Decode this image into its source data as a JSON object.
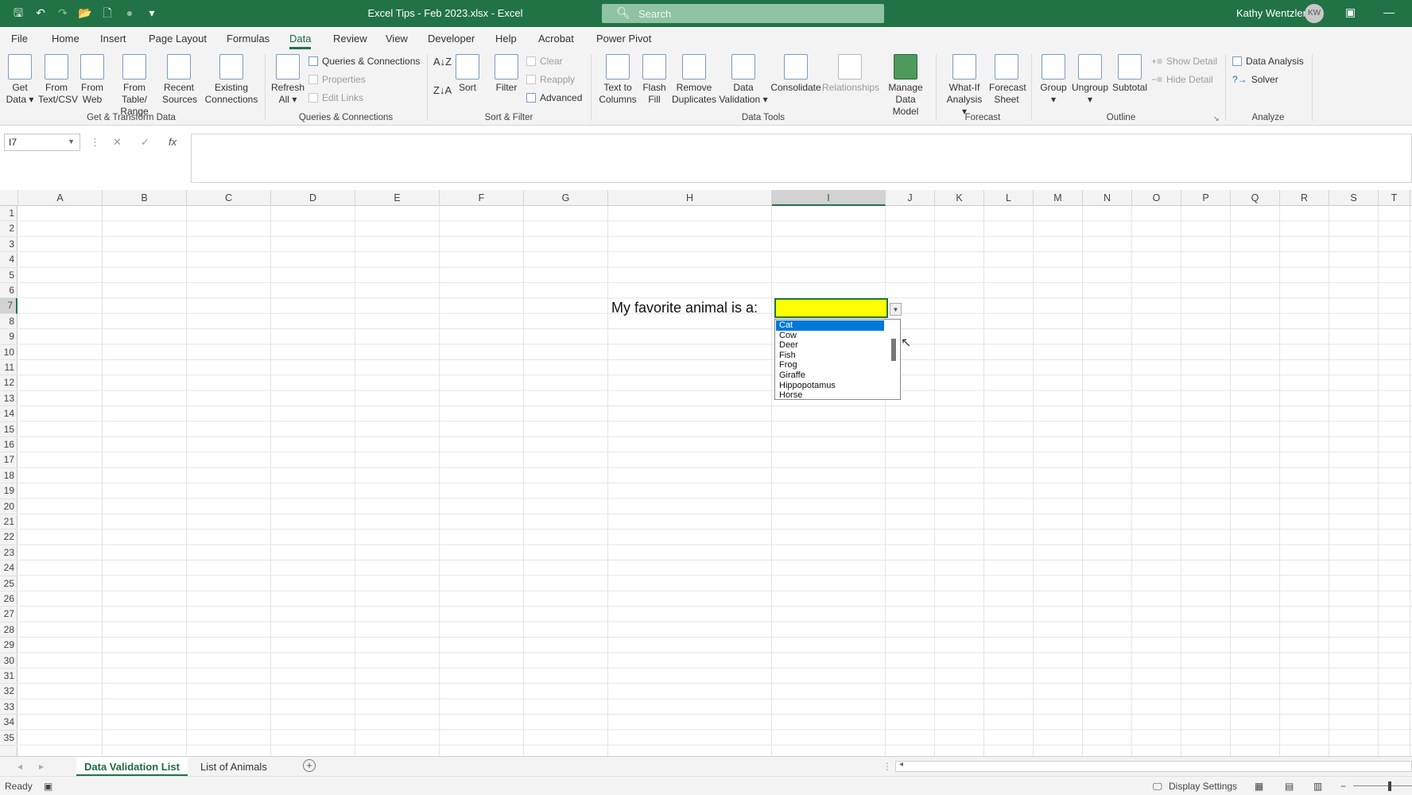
{
  "window": {
    "title": "Excel Tips - Feb 2023.xlsx  -  Excel",
    "search_placeholder": "Search",
    "user_name": "Kathy Wentzler",
    "user_initials": "KW"
  },
  "tabs": [
    "File",
    "Home",
    "Insert",
    "Page Layout",
    "Formulas",
    "Data",
    "Review",
    "View",
    "Developer",
    "Help",
    "Acrobat",
    "Power Pivot"
  ],
  "active_tab": "Data",
  "ribbon": {
    "get_transform": {
      "group_label": "Get & Transform Data",
      "get_data": "Get Data",
      "from_text": "From Text/CSV",
      "from_web": "From Web",
      "from_table": "From Table/ Range",
      "recent_sources": "Recent Sources",
      "existing_connections": "Existing Connections"
    },
    "queries": {
      "group_label": "Queries & Connections",
      "refresh_all": "Refresh All",
      "queries_connections": "Queries & Connections",
      "properties": "Properties",
      "edit_links": "Edit Links"
    },
    "sort_filter": {
      "group_label": "Sort & Filter",
      "sort": "Sort",
      "filter": "Filter",
      "clear": "Clear",
      "reapply": "Reapply",
      "advanced": "Advanced"
    },
    "data_tools": {
      "group_label": "Data Tools",
      "text_to_columns": "Text to Columns",
      "flash_fill": "Flash Fill",
      "remove_duplicates": "Remove Duplicates",
      "data_validation": "Data Validation",
      "consolidate": "Consolidate",
      "relationships": "Relationships",
      "manage_data_model": "Manage Data Model"
    },
    "forecast": {
      "group_label": "Forecast",
      "what_if": "What-If Analysis",
      "forecast_sheet": "Forecast Sheet"
    },
    "outline": {
      "group_label": "Outline",
      "group": "Group",
      "ungroup": "Ungroup",
      "subtotal": "Subtotal",
      "show_detail": "Show Detail",
      "hide_detail": "Hide Detail"
    },
    "analyze": {
      "group_label": "Analyze",
      "data_analysis": "Data Analysis",
      "solver": "Solver"
    }
  },
  "formula_bar": {
    "name_box": "I7",
    "formula": ""
  },
  "columns": [
    "A",
    "B",
    "C",
    "D",
    "E",
    "F",
    "G",
    "H",
    "I",
    "J",
    "K",
    "L",
    "M",
    "N",
    "O",
    "P",
    "Q",
    "R",
    "S",
    "T"
  ],
  "rows": [
    "1",
    "2",
    "3",
    "4",
    "5",
    "6",
    "7",
    "8",
    "9",
    "10",
    "11",
    "12",
    "13",
    "14",
    "15",
    "16",
    "17",
    "18",
    "19",
    "20",
    "21",
    "22",
    "23",
    "24",
    "25",
    "26",
    "27",
    "28",
    "29",
    "30",
    "31",
    "32",
    "33",
    "34",
    "35"
  ],
  "selected_cell": {
    "column": "I",
    "row": "7"
  },
  "sheet": {
    "label_h7": "My favorite animal is a:",
    "cell_i7_fill": "#ffff00"
  },
  "dropdown": {
    "options": [
      "Cat",
      "Cow",
      "Deer",
      "Fish",
      "Frog",
      "Giraffe",
      "Hippopotamus",
      "Horse"
    ],
    "highlighted": "Cat"
  },
  "sheet_tabs": [
    "Data Validation List",
    "List of Animals"
  ],
  "active_sheet": "Data Validation List",
  "status": {
    "ready": "Ready",
    "display_settings": "Display Settings"
  },
  "colors": {
    "excel_green": "#217346",
    "highlight_blue": "#0078d7",
    "cell_yellow": "#ffff00"
  }
}
